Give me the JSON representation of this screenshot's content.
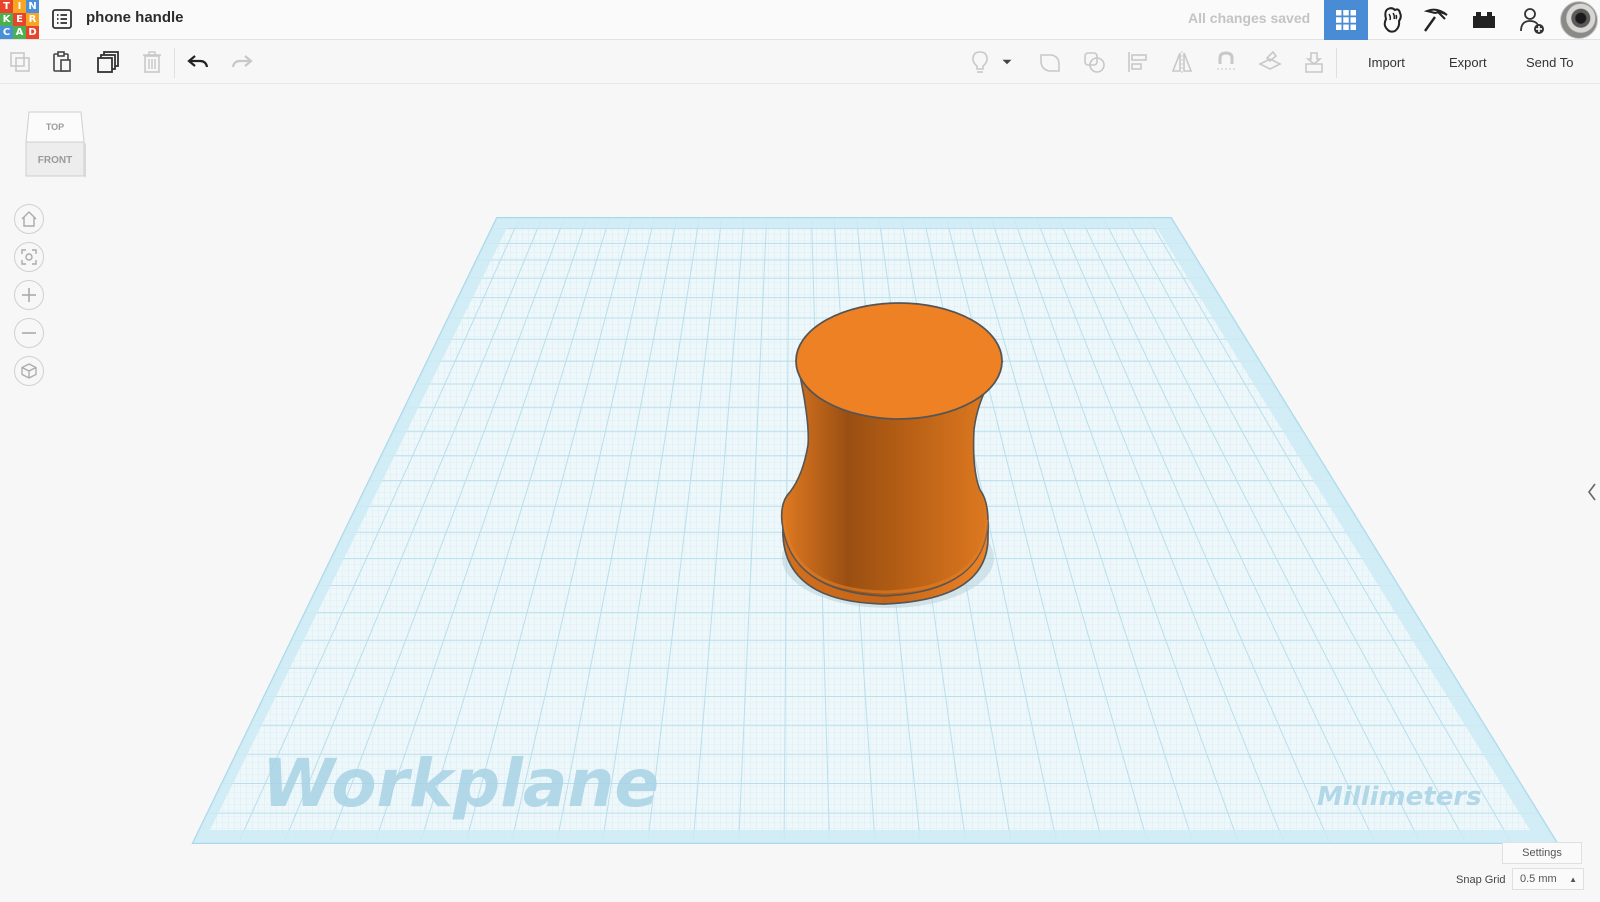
{
  "header": {
    "logo_letters": [
      "T",
      "I",
      "N",
      "K",
      "E",
      "R",
      "C",
      "A",
      "D"
    ],
    "logo_colors": [
      "#e7442b",
      "#f6a623",
      "#4a90d9",
      "#4caf50",
      "#e7442b",
      "#f6a623",
      "#4a90d9",
      "#4caf50",
      "#e7442b"
    ],
    "design_title": "phone handle",
    "save_status": "All changes saved",
    "buttons": [
      {
        "name": "3d-design-view",
        "icon": "grid-icon",
        "active": true
      },
      {
        "name": "codeblocks-view",
        "icon": "fist-icon",
        "active": false
      },
      {
        "name": "minecraft-view",
        "icon": "pickaxe-icon",
        "active": false
      },
      {
        "name": "bricks-view",
        "icon": "brick-icon",
        "active": false
      },
      {
        "name": "share-user",
        "icon": "add-user-icon",
        "active": false
      }
    ]
  },
  "toolbar": {
    "icons": [
      "copy-icon",
      "paste-icon",
      "duplicate-icon",
      "delete-icon",
      "undo-icon",
      "redo-icon",
      "light-bulb-icon",
      "dropdown-icon",
      "group-icon",
      "ungroup-icon",
      "align-icon",
      "mirror-icon",
      "magnet-icon",
      "workplane-icon",
      "drop-icon"
    ],
    "import_label": "Import",
    "export_label": "Export",
    "send_to_label": "Send To"
  },
  "viewcube": {
    "top_label": "TOP",
    "front_label": "FRONT"
  },
  "nav_controls": [
    "home-icon",
    "fit-icon",
    "zoom-in-icon",
    "zoom-out-icon",
    "perspective-icon"
  ],
  "workplane": {
    "label": "Workplane",
    "units_label": "Millimeters",
    "grid_color": "#b9dfec",
    "border_color": "#a8d8ea"
  },
  "shape": {
    "color": "#ee7f24"
  },
  "footer": {
    "settings_label": "Settings",
    "snap_grid_label": "Snap Grid",
    "snap_grid_value": "0.5 mm"
  },
  "colors": {
    "accent": "#4a8bd6"
  }
}
